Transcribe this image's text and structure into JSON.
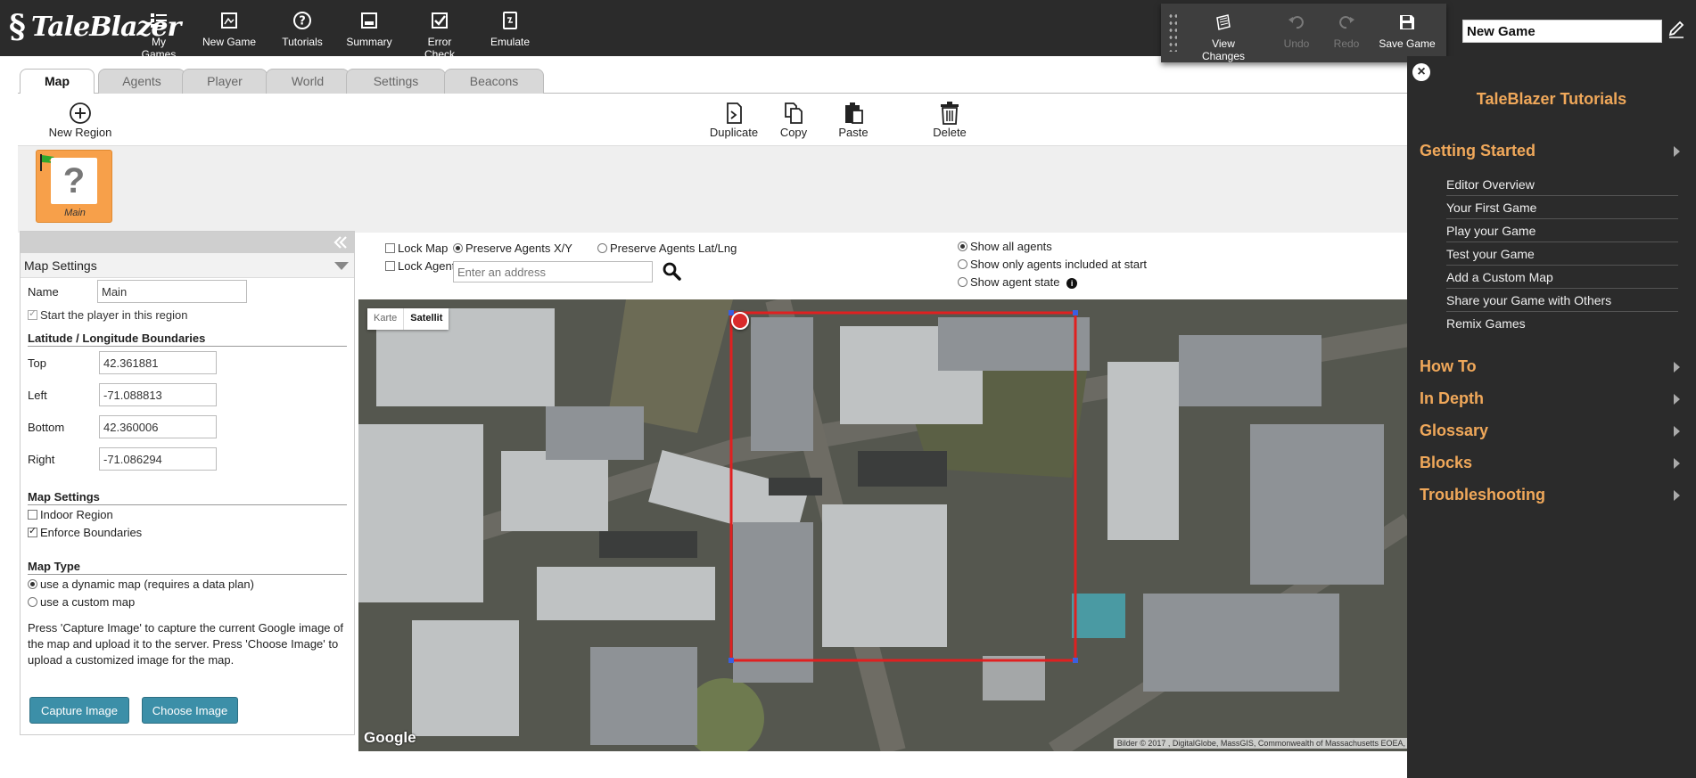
{
  "app": {
    "logo_text": "TaleBlazer"
  },
  "topbar": {
    "buttons": [
      {
        "label": "My Games",
        "icon": "list-icon"
      },
      {
        "label": "New Game",
        "icon": "new-game-icon"
      },
      {
        "label": "Tutorials",
        "icon": "help-icon"
      },
      {
        "label": "Summary",
        "icon": "summary-icon"
      },
      {
        "label": "Error Check",
        "icon": "check-icon"
      },
      {
        "label": "Emulate",
        "icon": "emulate-icon"
      }
    ],
    "history": {
      "view_changes": "View Changes",
      "undo": "Undo",
      "redo": "Redo",
      "save": "Save Game"
    },
    "game_name": "New Game"
  },
  "tabs": [
    {
      "label": "Map",
      "active": true
    },
    {
      "label": "Agents",
      "active": false
    },
    {
      "label": "Player",
      "active": false
    },
    {
      "label": "World",
      "active": false
    },
    {
      "label": "Settings",
      "active": false
    },
    {
      "label": "Beacons",
      "active": false
    }
  ],
  "toolbar": {
    "new_region": "New Region",
    "duplicate": "Duplicate",
    "copy": "Copy",
    "paste": "Paste",
    "delete": "Delete"
  },
  "regions": [
    {
      "label": "Main",
      "thumb": "?"
    }
  ],
  "settings": {
    "header": "Map Settings",
    "name_label": "Name",
    "name_value": "Main",
    "start_player": "Start the player in this region",
    "boundaries_title": "Latitude / Longitude Boundaries",
    "top_label": "Top",
    "top_value": "42.361881",
    "left_label": "Left",
    "left_value": "-71.088813",
    "bottom_label": "Bottom",
    "bottom_value": "42.360006",
    "right_label": "Right",
    "right_value": "-71.086294",
    "map_settings_title": "Map Settings",
    "indoor": "Indoor Region",
    "enforce": "Enforce Boundaries",
    "map_type_title": "Map Type",
    "dynamic": "use a dynamic map (requires a data plan)",
    "custom": "use a custom map",
    "help": "Press 'Capture Image' to capture the current Google image of the map and upload it to the server. Press 'Choose Image' to upload a customized image for the map.",
    "capture": "Capture Image",
    "choose": "Choose Image"
  },
  "mapcontrols": {
    "lock_map": "Lock Map",
    "lock_agents": "Lock Agents",
    "preserve_xy": "Preserve Agents X/Y",
    "preserve_latlng": "Preserve Agents Lat/Lng",
    "address_placeholder": "Enter an address",
    "show_all": "Show all agents",
    "show_start": "Show only agents included at start",
    "show_state": "Show agent state"
  },
  "map": {
    "type_karte": "Karte",
    "type_satellit": "Satellit",
    "google": "Google",
    "attribution": "Bilder © 2017 , DigitalGlobe, MassGIS, Commonwealth of Massachusetts EOEA,"
  },
  "tutorials": {
    "title": "TaleBlazer Tutorials",
    "categories": [
      {
        "label": "Getting Started"
      },
      {
        "label": "How To"
      },
      {
        "label": "In Depth"
      },
      {
        "label": "Glossary"
      },
      {
        "label": "Blocks"
      },
      {
        "label": "Troubleshooting"
      }
    ],
    "getting_started_items": [
      "Editor Overview",
      "Your First Game",
      "Play your Game",
      "Test your Game",
      "Add a Custom Map",
      "Share your Game with Others",
      "Remix Games"
    ]
  },
  "colors": {
    "accent": "#f0a85a",
    "topbar": "#2b2b2b",
    "button_blue": "#3c8fa8",
    "boundary_red": "#e02020"
  }
}
